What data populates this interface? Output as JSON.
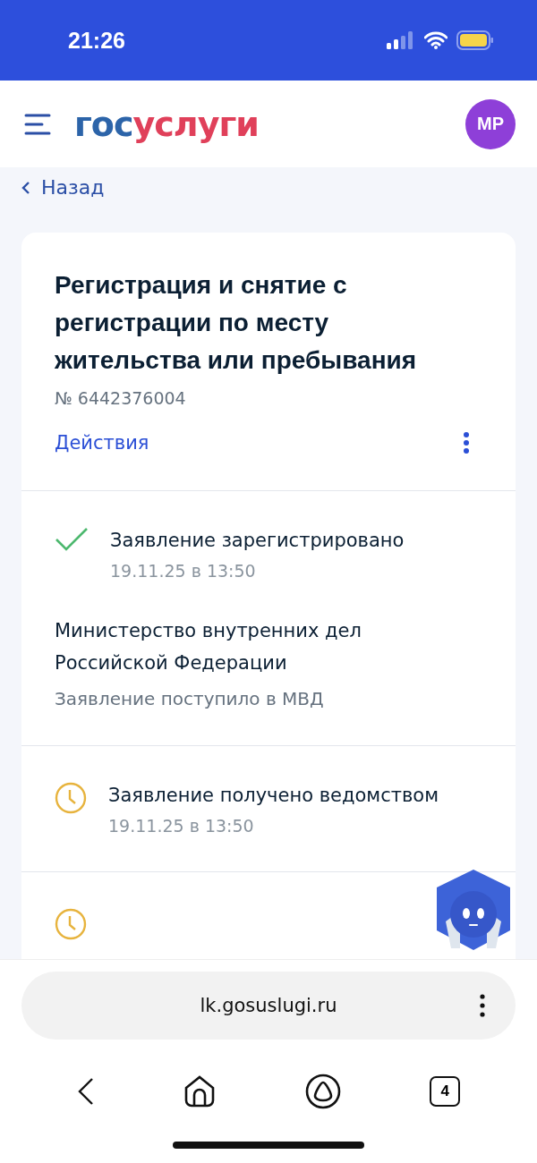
{
  "status_bar": {
    "time": "21:26"
  },
  "header": {
    "logo": {
      "part_1": "гос",
      "part_2": "услуги"
    },
    "avatar": "МР"
  },
  "back_link": "Назад",
  "application": {
    "title": "Регистрация и снятие с регистрации по месту жительства или пребывания",
    "number": "№ 6442376004",
    "actions": "Действия"
  },
  "statuses": [
    {
      "kind": "done",
      "title": "Заявление зарегистрировано",
      "date": "19.11.25 в 13:50",
      "org": "Министерство внутренних дел Российской Федерации",
      "note": "Заявление поступило в МВД"
    },
    {
      "kind": "pending",
      "title": "Заявление получено ведомством",
      "date": "19.11.25 в 13:50"
    },
    {
      "kind": "pending"
    }
  ],
  "browser": {
    "url": "lk.gosuslugi.ru",
    "tabs_count": "4"
  }
}
